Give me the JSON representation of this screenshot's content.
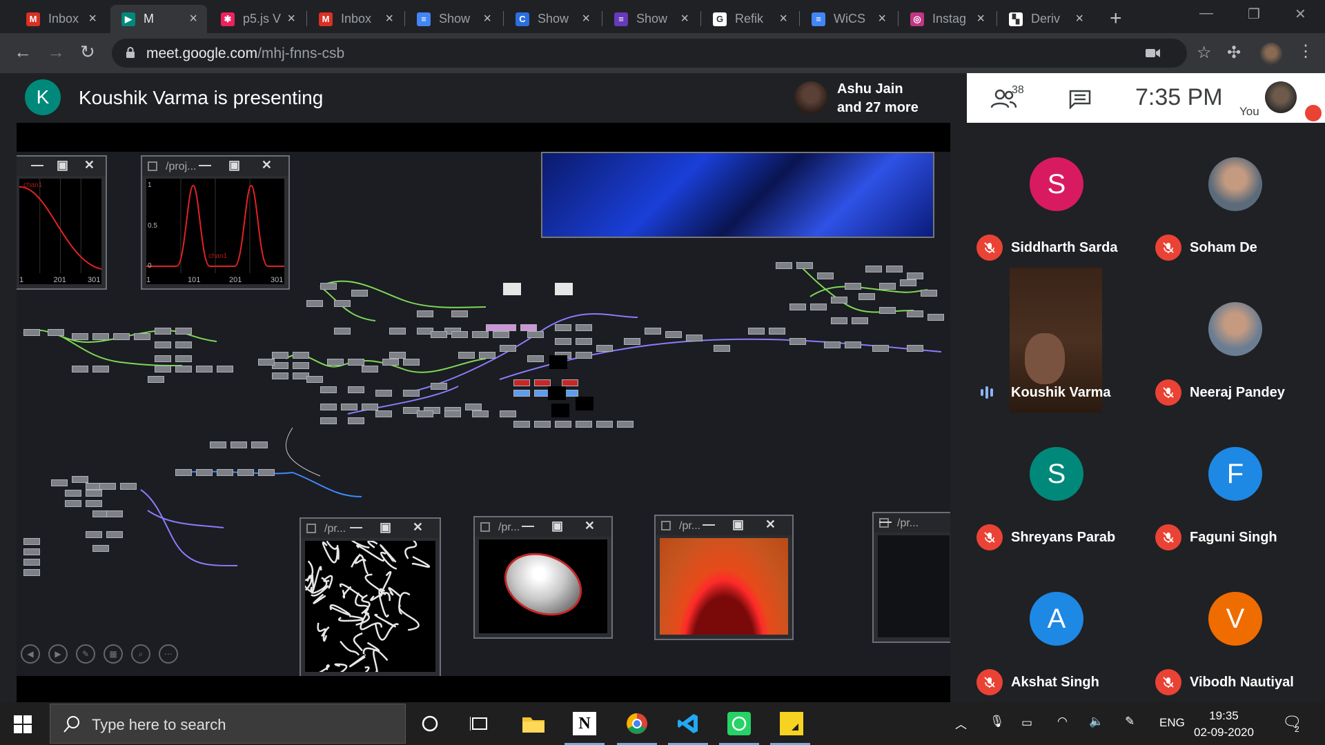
{
  "browser": {
    "tabs": [
      {
        "title": "Inbox",
        "icon": "gmail-icon",
        "color": "#d93025",
        "glyph": "M"
      },
      {
        "title": "M",
        "icon": "meet-icon",
        "color": "#00897b",
        "glyph": "▶"
      },
      {
        "title": "p5.js V",
        "icon": "p5js-icon",
        "color": "#ed225d",
        "glyph": "✱"
      },
      {
        "title": "Inbox",
        "icon": "gmail-icon",
        "color": "#d93025",
        "glyph": "M"
      },
      {
        "title": "Show",
        "icon": "docs-icon",
        "color": "#4285f4",
        "glyph": "≡"
      },
      {
        "title": "Show",
        "icon": "canva-icon",
        "color": "#2b6ee0",
        "glyph": "C"
      },
      {
        "title": "Show",
        "icon": "forms-icon",
        "color": "#673ab7",
        "glyph": "≡"
      },
      {
        "title": "Refik",
        "icon": "google-icon",
        "color": "#ffffff",
        "glyph": "G"
      },
      {
        "title": "WiCS",
        "icon": "docs-icon",
        "color": "#4285f4",
        "glyph": "≡"
      },
      {
        "title": "Instag",
        "icon": "instagram-icon",
        "color": "#c13584",
        "glyph": "◎"
      },
      {
        "title": "Deriv",
        "icon": "derivative-icon",
        "color": "#ffffff",
        "glyph": "▚"
      }
    ],
    "url_host": "meet.google.com",
    "url_path": "/mhj-fnns-csb"
  },
  "meet": {
    "presenter_initial": "K",
    "presenter_text": "Koushik Varma is presenting",
    "others_name": "Ashu Jain",
    "others_more": "and 27 more",
    "people_count": "38",
    "time": "7:35 PM",
    "you_label": "You"
  },
  "participants": [
    {
      "name": "Siddharth Sarda",
      "initial": "S",
      "color": "#d81b60",
      "type": "avatar"
    },
    {
      "name": "Soham De",
      "initial": "",
      "color": "#5b6b7a",
      "type": "photo"
    },
    {
      "name": "Koushik Varma",
      "initial": "",
      "color": "#4a3020",
      "type": "video"
    },
    {
      "name": "Neeraj Pandey",
      "initial": "",
      "color": "#6b7d92",
      "type": "photo"
    },
    {
      "name": "Shreyans Parab",
      "initial": "S",
      "color": "#00897b",
      "type": "avatar"
    },
    {
      "name": "Faguni Singh",
      "initial": "F",
      "color": "#1e88e5",
      "type": "avatar"
    },
    {
      "name": "Akshat Singh",
      "initial": "A",
      "color": "#1e88e5",
      "type": "avatar"
    },
    {
      "name": "Vibodh Nautiyal",
      "initial": "V",
      "color": "#ef6c00",
      "type": "avatar"
    }
  ],
  "screenshare": {
    "windows": [
      {
        "title": "",
        "kind": "chart-fall"
      },
      {
        "title": "/proj...",
        "kind": "chart-pulse"
      },
      {
        "title": "/pr...",
        "kind": "noise"
      },
      {
        "title": "/pr...",
        "kind": "sphere"
      },
      {
        "title": "/pr...",
        "kind": "glow"
      },
      {
        "title": "/pr...",
        "kind": "dark"
      }
    ],
    "chart1_ticks": [
      "1",
      "201",
      "301"
    ],
    "chart2_ticks": [
      "1",
      "101",
      "201",
      "301"
    ],
    "chart2_yticks": [
      "1",
      "0.5",
      "0"
    ],
    "chart_label": "chan1"
  },
  "taskbar": {
    "search_placeholder": "Type here to search",
    "language": "ENG",
    "time": "19:35",
    "date": "02-09-2020",
    "notifications": "2"
  }
}
